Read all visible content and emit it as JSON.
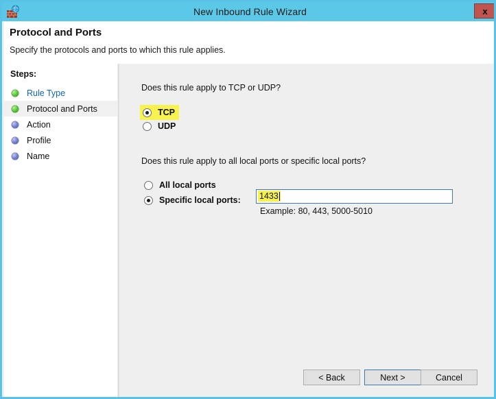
{
  "window": {
    "title": "New Inbound Rule Wizard",
    "icon": "firewall-icon",
    "close_label": "x",
    "titlebar_color": "#5bc8e8",
    "border_color": "#5bc2e7"
  },
  "header": {
    "title": "Protocol and Ports",
    "subtitle": "Specify the protocols and ports to which this rule applies."
  },
  "sidebar": {
    "heading": "Steps:",
    "items": [
      {
        "label": "Rule Type",
        "state": "done",
        "is_link": true,
        "current": false
      },
      {
        "label": "Protocol and Ports",
        "state": "done",
        "is_link": false,
        "current": true
      },
      {
        "label": "Action",
        "state": "todo",
        "is_link": false,
        "current": false
      },
      {
        "label": "Profile",
        "state": "todo",
        "is_link": false,
        "current": false
      },
      {
        "label": "Name",
        "state": "todo",
        "is_link": false,
        "current": false
      }
    ]
  },
  "main": {
    "protocol_question": "Does this rule apply to TCP or UDP?",
    "protocol_options": [
      {
        "label": "TCP",
        "selected": true,
        "highlighted": true
      },
      {
        "label": "UDP",
        "selected": false,
        "highlighted": false
      }
    ],
    "ports_question": "Does this rule apply to all local ports or specific local ports?",
    "ports_options": [
      {
        "label": "All local ports",
        "selected": false
      },
      {
        "label": "Specific local ports:",
        "selected": true
      }
    ],
    "port_input": {
      "value": "1433",
      "placeholder": "",
      "highlight_color": "#f7f24e",
      "focused": true
    },
    "port_example": "Example: 80, 443, 5000-5010"
  },
  "footer": {
    "back_label": "< Back",
    "next_label": "Next >",
    "cancel_label": "Cancel"
  }
}
